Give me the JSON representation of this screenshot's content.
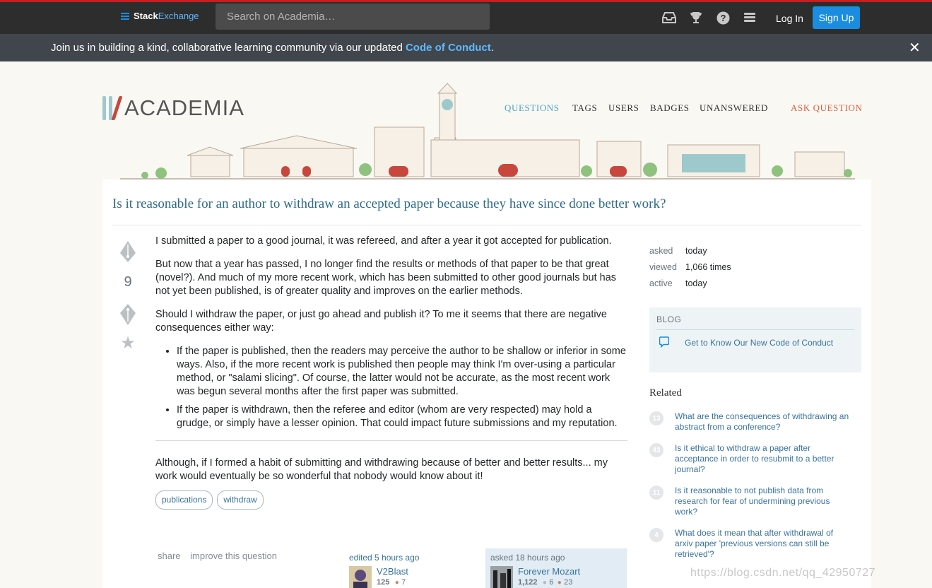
{
  "topbar": {
    "brand_first": "Stack",
    "brand_second": "Exchange",
    "search_placeholder": "Search on Academia…",
    "login_label": "Log In",
    "signup_label": "Sign Up",
    "icons": [
      "inbox-icon",
      "achievements-icon",
      "help-icon",
      "site-switcher-icon"
    ]
  },
  "notice": {
    "text": "Join us in building a kind, collaborative learning community via our updated ",
    "link": "Code of Conduct",
    "end": ".",
    "close": "✕"
  },
  "site": {
    "logo_text": "ACADEMIA",
    "nav": {
      "questions": "QUESTIONS",
      "tags": "TAGS",
      "users": "USERS",
      "badges": "BADGES",
      "unanswered": "UNANSWERED",
      "ask": "ASK QUESTION"
    },
    "colors": {
      "accent": "#4aa6c0",
      "ask": "#d9603f",
      "link": "#39739d"
    }
  },
  "question": {
    "title": "Is it reasonable for an author to withdraw an accepted paper because they have since done better work?",
    "votes": "9",
    "p1": "I submitted a paper to a good journal, it was refereed, and after a year it got accepted for publication.",
    "p2": "But now that a year has passed, I no longer find the results or methods of that paper to be that great (novel?). And much of my more recent work, which has been submitted to other good journals but has not yet been published, is of greater quality and improves on the earlier methods.",
    "p3": "Should I withdraw the paper, or just go ahead and publish it? To me it seems that there are negative consequences either way:",
    "bullet1": "If the paper is published, then the readers may perceive the author to be shallow or inferior in some ways. Also, if the more recent work is published then people may think I'm over-using a particular method, or \"salami slicing\". Of course, the latter would not be accurate, as the most recent work was begun several months after the first paper was submitted.",
    "bullet2": "If the paper is withdrawn, then the referee and editor (whom are very respected) may hold a grudge, or simply have a lesser opinion. That could impact future submissions and my reputation.",
    "p4": "Although, if I formed a habit of submitting and withdrawing because of better and better results... my work would eventually be so wonderful that nobody would know about it!",
    "tags": [
      "publications",
      "withdraw"
    ],
    "share": "share",
    "improve": "improve this question",
    "edited": {
      "prefix": "edited",
      "time": "5 hours ago",
      "user": "V2Blast",
      "rep": "125",
      "badges": "7"
    },
    "asked": {
      "prefix": "asked",
      "time": "18 hours ago",
      "user": "Forever Mozart",
      "rep": "1,122",
      "silver": "6",
      "bronze": "23"
    }
  },
  "stats": {
    "asked_label": "asked",
    "asked_value": "today",
    "viewed_label": "viewed",
    "viewed_value": "1,066 times",
    "active_label": "active",
    "active_value": "today"
  },
  "blog": {
    "header": "BLOG",
    "item": "Get to Know Our New Code of Conduct"
  },
  "related": {
    "header": "Related",
    "items": [
      {
        "score": "13",
        "text": "What are the consequences of withdrawing an abstract from a conference?"
      },
      {
        "score": "43",
        "text": "Is it ethical to withdraw a paper after acceptance in order to resubmit to a better journal?"
      },
      {
        "score": "11",
        "text": "Is it reasonable to not publish data from research for fear of undermining previous work?"
      },
      {
        "score": "4",
        "text": "What does it mean that after withdrawal of arxiv paper 'previous versions can still be retrieved'?"
      }
    ]
  },
  "watermark": "https://blog.csdn.net/qq_42950727"
}
